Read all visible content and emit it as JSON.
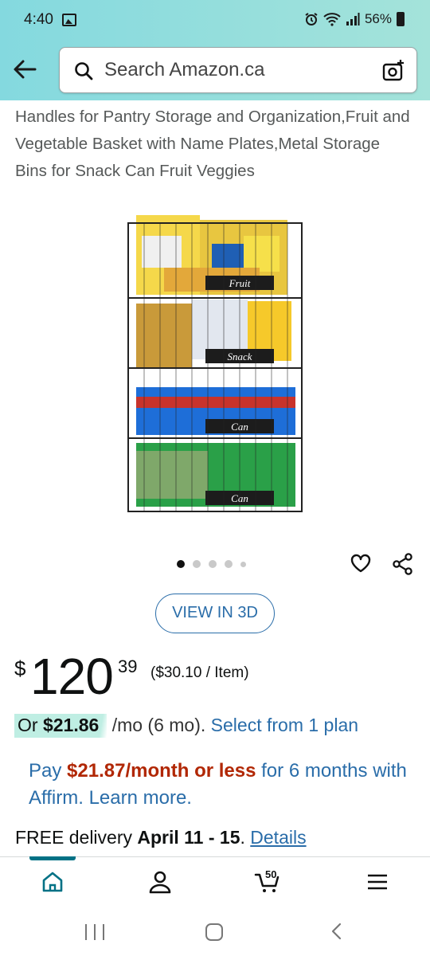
{
  "status_bar": {
    "time": "4:40",
    "battery": "56%",
    "icons": [
      "photo-icon",
      "alarm-icon",
      "wifi-icon",
      "signal-icon",
      "battery-icon"
    ]
  },
  "search": {
    "placeholder": "Search Amazon.ca"
  },
  "product": {
    "title": "Handles for Pantry Storage and Organization,Fruit and Vegetable Basket with Name Plates,Metal Storage Bins for Snack Can Fruit Veggies",
    "image_labels": [
      "Fruit",
      "Snack",
      "Can",
      "Can"
    ],
    "image_dots": 5,
    "active_dot": 0,
    "view3d_label": "VIEW IN 3D",
    "price": {
      "symbol": "$",
      "whole": "120",
      "fraction": "39",
      "unit_price": "($30.10 / Item)"
    },
    "monthly": {
      "prefix": "Or ",
      "amount": "$21.86",
      "suffix": " /mo (6 mo). ",
      "link": "Select from 1 plan"
    },
    "affirm": {
      "pay": "Pay ",
      "amount": "$21.87/month or less",
      "rest": " for 6 months with Affirm. Learn more."
    },
    "delivery": {
      "prefix": "FREE delivery ",
      "dates": "April 11 - 15",
      "separator": ". ",
      "link": "Details"
    }
  },
  "bottom_nav": {
    "items": [
      "home-icon",
      "account-icon",
      "cart-icon",
      "menu-icon"
    ],
    "cart_count": "50"
  },
  "colors": {
    "header_gradient_start": "#84d9df",
    "header_gradient_end": "#a4e3da",
    "link": "#2a6da9",
    "price_red": "#b12704",
    "teal_active": "#007185",
    "monthly_highlight": "#bfeee3"
  }
}
